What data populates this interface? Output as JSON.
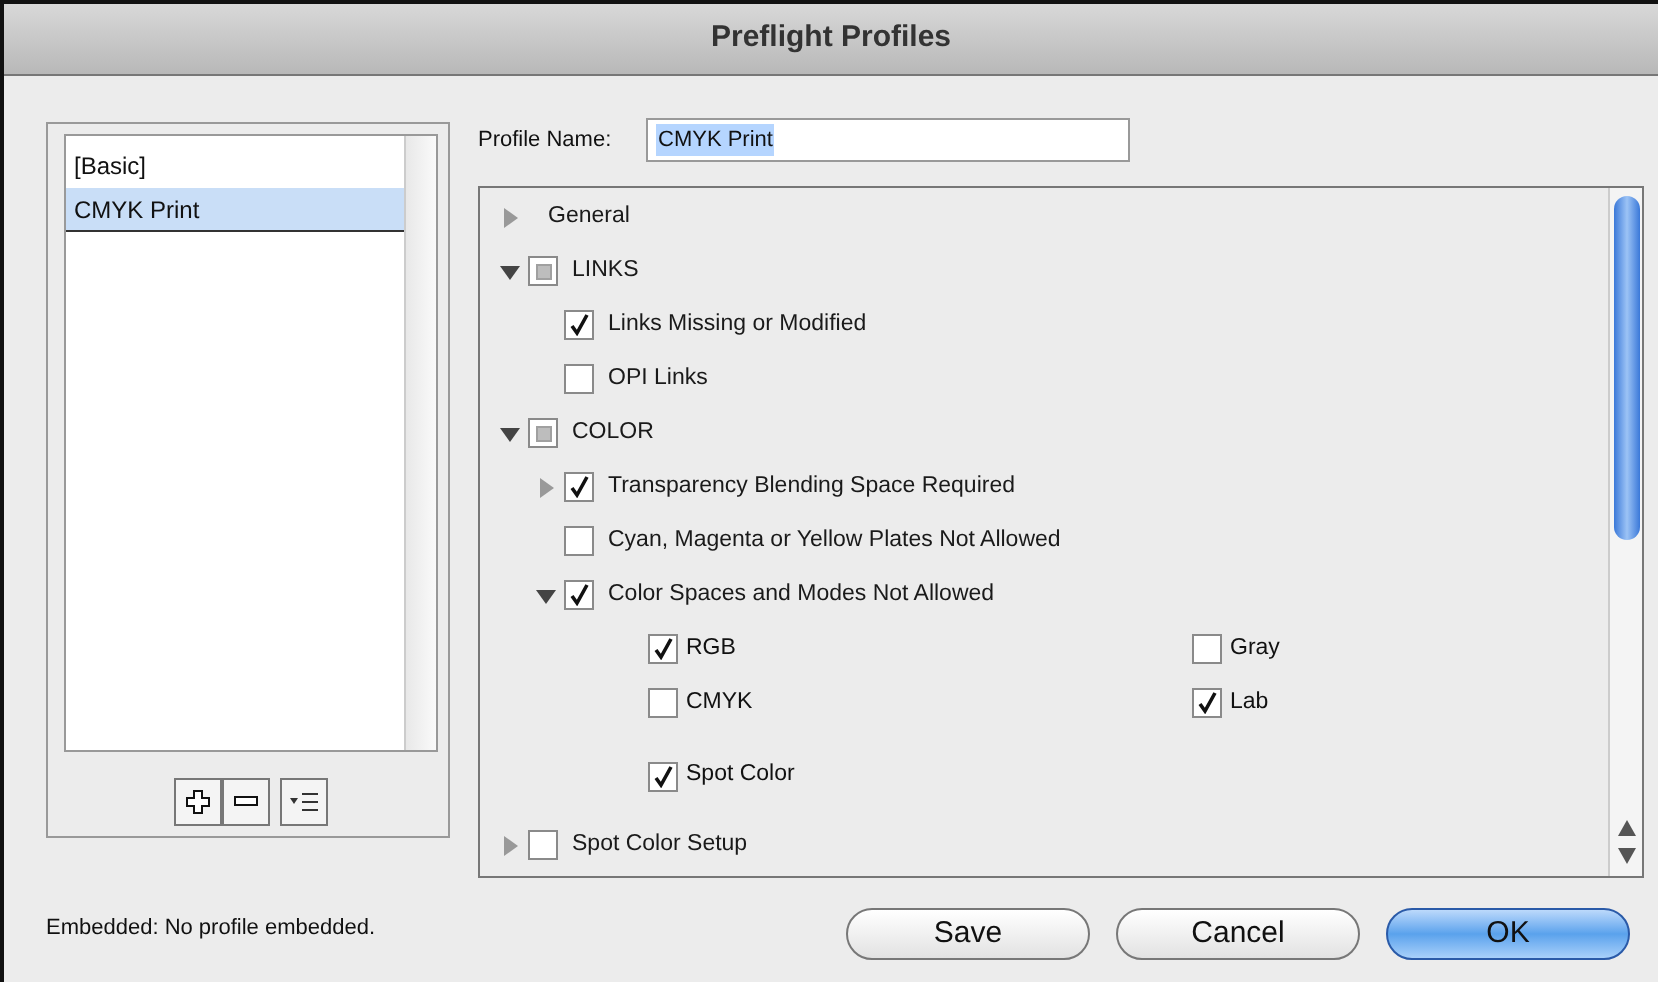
{
  "window": {
    "title": "Preflight Profiles"
  },
  "profiles": [
    {
      "label": "[Basic]",
      "selected": false
    },
    {
      "label": "CMYK Print",
      "selected": true
    }
  ],
  "list_buttons": [
    {
      "kind": "add"
    },
    {
      "kind": "remove"
    },
    {
      "kind": "menu"
    }
  ],
  "embedded": "Embedded:  No profile embedded.",
  "profile_name": {
    "label": "Profile Name:",
    "value": "CMYK Print"
  },
  "tree": [
    {
      "kind": "section",
      "label": "General",
      "expanded": false
    },
    {
      "kind": "check",
      "label": "LINKS",
      "expanded": true,
      "checked": false,
      "mixed": true,
      "children": [
        {
          "kind": "check",
          "label": "Links Missing or Modified",
          "checked": true
        },
        {
          "kind": "check",
          "label": "OPI Links",
          "checked": false
        }
      ]
    },
    {
      "kind": "check",
      "label": "COLOR",
      "expanded": true,
      "checked": false,
      "mixed": true,
      "children": [
        {
          "kind": "check",
          "label": "Transparency Blending Space Required",
          "expanded": false,
          "checked": true
        },
        {
          "kind": "check",
          "label": "Cyan, Magenta or Yellow Plates Not Allowed",
          "checked": false
        },
        {
          "kind": "check",
          "label": "Color Spaces and Modes Not Allowed",
          "expanded": true,
          "checked": true,
          "options": [
            {
              "label": "RGB",
              "checked": true
            },
            {
              "label": "Gray",
              "checked": false
            },
            {
              "label": "CMYK",
              "checked": false
            },
            {
              "label": "Lab",
              "checked": true
            },
            {
              "label": "Spot Color",
              "checked": true
            }
          ]
        }
      ]
    },
    {
      "kind": "check",
      "label": "Spot Color Setup",
      "expanded": false,
      "checked": false
    }
  ],
  "buttons": [
    {
      "label": "Save",
      "default": false
    },
    {
      "label": "Cancel",
      "default": false
    },
    {
      "label": "OK",
      "default": true
    }
  ]
}
